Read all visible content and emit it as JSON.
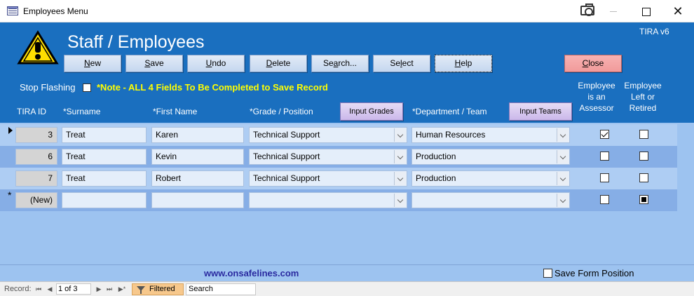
{
  "window": {
    "title": "Employees Menu",
    "close_glyph": "✕",
    "icons": [
      "app-form-icon",
      "camera-icon",
      "minimize-icon",
      "maximize-icon",
      "close-icon"
    ]
  },
  "header": {
    "title": "Staff / Employees",
    "version": "TIRA v6",
    "buttons": {
      "new": {
        "pre": "",
        "ul": "N",
        "post": "ew"
      },
      "save": {
        "pre": "",
        "ul": "S",
        "post": "ave"
      },
      "undo": {
        "pre": "",
        "ul": "U",
        "post": "ndo"
      },
      "delete": {
        "pre": "",
        "ul": "D",
        "post": "elete"
      },
      "search": {
        "pre": "Se",
        "ul": "a",
        "post": "rch..."
      },
      "select": {
        "pre": "Se",
        "ul": "l",
        "post": "ect"
      },
      "help": {
        "pre": "",
        "ul": "H",
        "post": "elp"
      },
      "close": {
        "pre": "",
        "ul": "C",
        "post": "lose"
      }
    },
    "stop_flashing_label": "Stop Flashing",
    "stop_flashing_checked": false,
    "note": "*Note - ALL 4 Fields To Be Completed to Save Record",
    "columns": {
      "tira_id": "TIRA ID",
      "surname": "*Surname",
      "first_name": "*First Name",
      "grade": "*Grade / Position",
      "department": "*Department / Team",
      "assessor": [
        "Employee",
        "is an",
        "Assessor"
      ],
      "left": [
        "Employee",
        "Left or",
        "Retired"
      ]
    },
    "input_grades_label": "Input Grades",
    "input_teams_label": "Input Teams",
    "colors": {
      "header_bg": "#1a6fbf",
      "note": "#ffff00",
      "close_btn": "#f19b9b"
    }
  },
  "records": [
    {
      "id": "3",
      "surname": "Treat",
      "first_name": "Karen",
      "grade": "Technical Support",
      "department": "Human Resources",
      "assessor": true,
      "left": false
    },
    {
      "id": "6",
      "surname": "Treat",
      "first_name": "Kevin",
      "grade": "Technical Support",
      "department": "Production",
      "assessor": false,
      "left": false
    },
    {
      "id": "7",
      "surname": "Treat",
      "first_name": "Robert",
      "grade": "Technical Support",
      "department": "Production",
      "assessor": false,
      "left": false
    },
    {
      "id": "(New)",
      "surname": "",
      "first_name": "",
      "grade": "",
      "department": "",
      "assessor": false,
      "left": "null"
    }
  ],
  "new_row_marker": "*",
  "footer": {
    "website": "www.onsafelines.com",
    "save_position_label": "Save Form Position",
    "save_position_checked": false
  },
  "navigation": {
    "record_label": "Record:",
    "current": "1 of 3",
    "filtered_label": "Filtered",
    "search_label": "Search",
    "glyphs": {
      "first": "⏮",
      "prev": "◀",
      "next": "▶",
      "last": "⏭",
      "new": "▶*"
    }
  }
}
